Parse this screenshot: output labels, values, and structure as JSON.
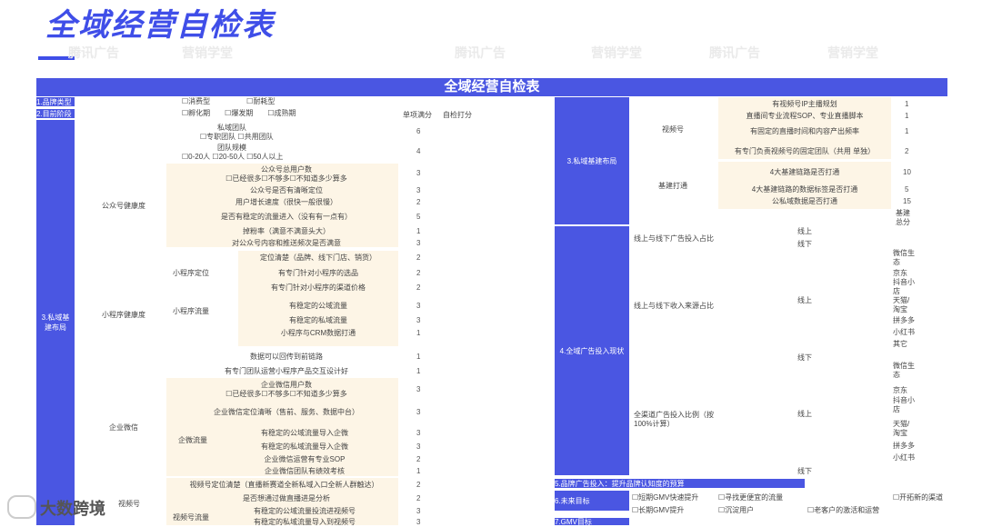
{
  "title": "全域经营自检表",
  "table_title": "全域经营自检表",
  "watermarks": [
    "腾讯广告",
    "营销学堂"
  ],
  "left": {
    "brand_type_label": "1.品牌类型",
    "brand_type_options": "☐消费型　　　　　☐耐耗型",
    "stage_label": "2.目前阶段",
    "stage_options": "☐孵化期　　☐爆发期　　☐成熟期",
    "col_full": "单项满分",
    "col_self": "自检打分",
    "team_label": "私域团队",
    "team_options": "☐专职团队 ☐共用团队",
    "team_score": "6",
    "scale_label": "团队规模",
    "scale_options": "☐0-20人 ☐20-50人 ☐50人以上",
    "scale_score": "4",
    "private_domain": "3.私域基建布局",
    "official_account": "公众号健康度",
    "oa_items": [
      {
        "t": "公众号总用户数\n☐已经很多☐不够多☐不知道多少算多",
        "s": "3"
      },
      {
        "t": "公众号是否有清晰定位",
        "s": "3"
      },
      {
        "t": "用户增长速度（很快一般很慢）",
        "s": "2"
      },
      {
        "t": "是否有稳定的流量进入（没有有一点有）",
        "s": "5"
      },
      {
        "t": "掉粉率（满意不满意头大）",
        "s": "1"
      },
      {
        "t": "对公众号内容和推送频次是否满意",
        "s": "3"
      }
    ],
    "mini_program": "小程序健康度",
    "mp_position": "小程序定位",
    "mp_traffic": "小程序流量",
    "mp_items": [
      {
        "t": "定位清楚（品牌、线下门店、销货）",
        "s": "2"
      },
      {
        "t": "有专门针对小程序的选品",
        "s": "2"
      },
      {
        "t": "有专门针对小程序的渠道价格",
        "s": "2"
      },
      {
        "t": "有稳定的公域流量",
        "s": "3"
      },
      {
        "t": "有稳定的私域流量",
        "s": "3"
      },
      {
        "t": "小程序与CRM数据打通",
        "s": "1"
      },
      {
        "t": "数据可以回传到前链路",
        "s": "1"
      },
      {
        "t": "有专门团队运营小程序产品交互设计好",
        "s": "1"
      }
    ],
    "wecom": "企业微信",
    "wecom_traffic": "企微流量",
    "wc_items": [
      {
        "t": "企业微信用户数\n☐已经很多☐不够多☐不知道多少算多",
        "s": "3"
      },
      {
        "t": "企业微信定位清晰（售前、服务、数据中台）",
        "s": "3"
      },
      {
        "t": "有稳定的公域流量导入企微",
        "s": "3"
      },
      {
        "t": "有稳定的私域流量导入企微",
        "s": "3"
      },
      {
        "t": "企业微信运营有专业SOP",
        "s": "2"
      },
      {
        "t": "企业微信团队有绩效考核",
        "s": "1"
      }
    ],
    "video_label": "视频号",
    "video_traffic": "视频号流量",
    "vd_items": [
      {
        "t": "视频号定位清楚（直播新赛道全新私域入口全新人群触达）",
        "s": "2"
      },
      {
        "t": "是否想通过做直播进是分析",
        "s": "2"
      },
      {
        "t": "有稳定的公域流量投流进视频号",
        "s": "3"
      },
      {
        "t": "有稳定的私域流量导入到视频号",
        "s": "3"
      }
    ]
  },
  "right": {
    "private_domain": "3.私域基建布局",
    "channels": "视频号",
    "ch_items": [
      {
        "t": "有视频号IP主播规划",
        "s": "1"
      },
      {
        "t": "直播间专业流程SOP、专业直播脚本",
        "s": "1"
      },
      {
        "t": "有固定的直播时间和内容产出频率",
        "s": "1"
      },
      {
        "t": "有专门负责视频号的固定团队（共用 单独）",
        "s": "2"
      }
    ],
    "infra": "基建打通",
    "inf_items": [
      {
        "t": "4大基建链路是否打通",
        "s": "10"
      },
      {
        "t": "4大基建链路的数据标签是否打通",
        "s": "5"
      },
      {
        "t": "公私域数据是否打通",
        "s": "15"
      }
    ],
    "infra_total": "基建总分",
    "ad_section": "4.全域广告投入现状",
    "ad_ratio": "线上与线下广告投入占比",
    "rev_ratio": "线上与线下收入来源占比",
    "channel_ratio": "全渠道广告投入比例（按100%计算）",
    "online": "线上",
    "offline": "线下",
    "platforms": [
      "微信生态",
      "京东",
      "抖音小店",
      "天猫/淘宝",
      "拼多多",
      "小红书",
      "其它"
    ],
    "platforms2": [
      "微信生态",
      "京东",
      "抖音小店",
      "天猫/淘宝",
      "拼多多",
      "小红书"
    ],
    "brand_ad": "5.品牌广告投入：提升品牌认知度的预算",
    "future": "6.未来目标",
    "short_term": "☐短期GMV快速提升",
    "find_traffic": "☐寻找更便宜的流量",
    "open_channel": "☐开拓新的渠道",
    "long_term": "☐长期GMV提升",
    "deposit": "☐沉淀用户",
    "old_customer": "☐老客户的激活和运营",
    "gmv_target": "7.GMV目标"
  },
  "logo_text": "大数跨境"
}
